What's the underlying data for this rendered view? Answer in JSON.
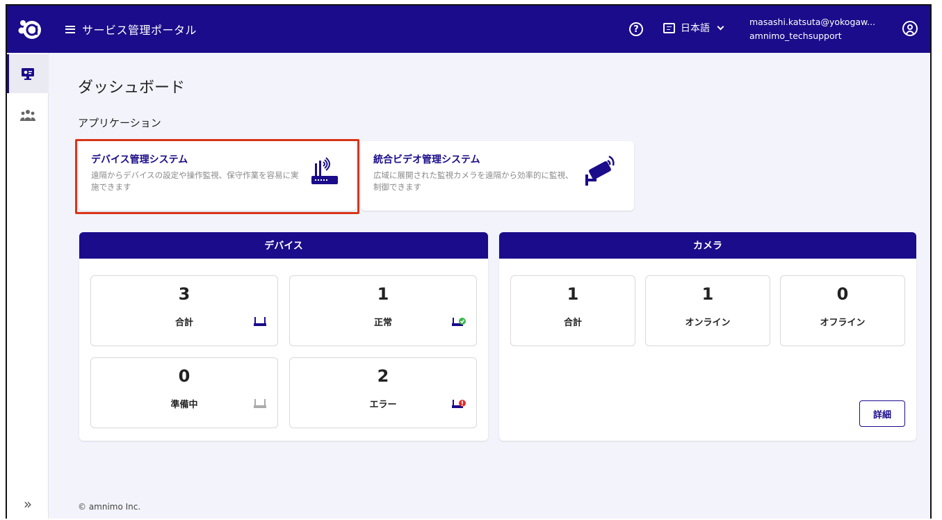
{
  "header": {
    "portal_title": "サービス管理ポータル",
    "language": "日本語",
    "user_email": "masashi.katsuta@yokogaw...",
    "user_org": "amnimo_techsupport",
    "help_glyph": "?"
  },
  "sidebar": {
    "expand_glyph": "»"
  },
  "main": {
    "page_title": "ダッシュボード",
    "applications_label": "アプリケーション",
    "apps": [
      {
        "title": "デバイス管理システム",
        "description": "遠隔からデバイスの設定や操作監視、保守作業を容易に実施できます"
      },
      {
        "title": "統合ビデオ管理システム",
        "description": "広域に展開された監視カメラを遠隔から効率的に監視、制御できます"
      }
    ]
  },
  "devices": {
    "title": "デバイス",
    "stats": [
      {
        "value": "3",
        "label": "合計"
      },
      {
        "value": "1",
        "label": "正常"
      },
      {
        "value": "0",
        "label": "準備中"
      },
      {
        "value": "2",
        "label": "エラー"
      }
    ]
  },
  "cameras": {
    "title": "カメラ",
    "stats": [
      {
        "value": "1",
        "label": "合計"
      },
      {
        "value": "1",
        "label": "オンライン"
      },
      {
        "value": "0",
        "label": "オフライン"
      }
    ],
    "detail_label": "詳細"
  },
  "footer": {
    "copyright": "© amnimo Inc."
  },
  "colors": {
    "brand": "#1a0c8a",
    "highlight": "#d93418",
    "ok": "#3ab54a",
    "error": "#e02b2b"
  }
}
